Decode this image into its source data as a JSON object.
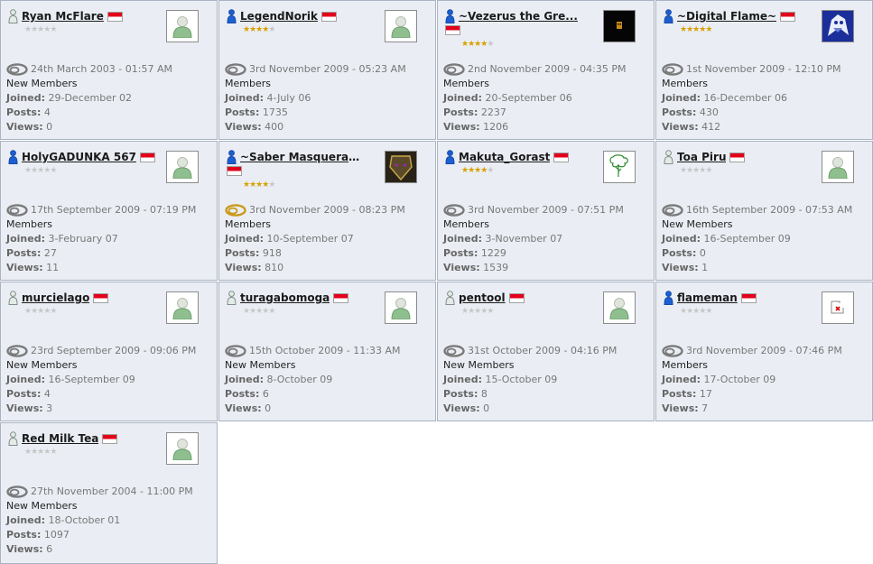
{
  "labels": {
    "joined": "Joined:",
    "posts": "Posts:",
    "views": "Views:"
  },
  "colors": {
    "card_bg": "#eaeef4",
    "card_border": "#a9b3c1",
    "flag_red": "#e3001b",
    "star_gold": "#d9a000",
    "rank_blue": "#1d5fd1"
  },
  "members": [
    {
      "name": "Ryan McFlare",
      "stars": 0,
      "rank_icon": "person-outline-icon",
      "avatar": "default-avatar-icon",
      "status": "offline-status-icon",
      "last_active": "24th March 2003 - 01:57 AM",
      "group": "New Members",
      "joined": "29-December 02",
      "posts": "4",
      "views": "0"
    },
    {
      "name": "LegendNorik",
      "stars": 4,
      "rank_icon": "person-blue-icon",
      "avatar": "default-avatar-icon",
      "status": "offline-status-icon",
      "last_active": "3rd November 2009 - 05:23 AM",
      "group": "Members",
      "joined": "4-July 06",
      "posts": "1735",
      "views": "400"
    },
    {
      "name": "~Vezerus the Gre...",
      "stars": 4,
      "rank_icon": "person-blue-icon",
      "avatar": "dark-pixel-avatar-icon",
      "status": "offline-status-icon",
      "last_active": "2nd November 2009 - 04:35 PM",
      "group": "Members",
      "joined": "20-September 06",
      "posts": "2237",
      "views": "1206"
    },
    {
      "name": "~Digital Flame~",
      "stars": 5,
      "rank_icon": "person-blue-icon",
      "avatar": "creature-avatar-icon",
      "status": "offline-status-icon",
      "last_active": "1st November 2009 - 12:10 PM",
      "group": "Members",
      "joined": "16-December 06",
      "posts": "430",
      "views": "412"
    },
    {
      "name": "HolyGADUNKA 567",
      "stars": 0,
      "rank_icon": "person-blue-icon",
      "avatar": "default-avatar-icon",
      "status": "offline-status-icon",
      "last_active": "17th September 2009 - 07:19 PM",
      "group": "Members",
      "joined": "3-February 07",
      "posts": "27",
      "views": "11"
    },
    {
      "name": "~Saber Masquerad...",
      "stars": 4,
      "rank_icon": "person-blue-icon",
      "avatar": "mask-avatar-icon",
      "status": "online-status-icon",
      "last_active": "3rd November 2009 - 08:23 PM",
      "group": "Members",
      "joined": "10-September 07",
      "posts": "918",
      "views": "810"
    },
    {
      "name": "Makuta_Gorast",
      "stars": 4,
      "rank_icon": "person-blue-icon",
      "avatar": "tree-avatar-icon",
      "status": "offline-status-icon",
      "last_active": "3rd November 2009 - 07:51 PM",
      "group": "Members",
      "joined": "3-November 07",
      "posts": "1229",
      "views": "1539"
    },
    {
      "name": "Toa Piru",
      "stars": 0,
      "rank_icon": "person-outline-icon",
      "avatar": "default-avatar-icon",
      "status": "offline-status-icon",
      "last_active": "16th September 2009 - 07:53 AM",
      "group": "New Members",
      "joined": "16-September 09",
      "posts": "0",
      "views": "1"
    },
    {
      "name": "murcielago",
      "stars": 0,
      "rank_icon": "person-outline-icon",
      "avatar": "default-avatar-icon",
      "status": "offline-status-icon",
      "last_active": "23rd September 2009 - 09:06 PM",
      "group": "New Members",
      "joined": "16-September 09",
      "posts": "4",
      "views": "3"
    },
    {
      "name": "turagabomoga",
      "stars": 0,
      "rank_icon": "person-outline-icon",
      "avatar": "default-avatar-icon",
      "status": "offline-status-icon",
      "last_active": "15th October 2009 - 11:33 AM",
      "group": "New Members",
      "joined": "8-October 09",
      "posts": "6",
      "views": "0"
    },
    {
      "name": "pentool",
      "stars": 0,
      "rank_icon": "person-outline-icon",
      "avatar": "default-avatar-icon",
      "status": "offline-status-icon",
      "last_active": "31st October 2009 - 04:16 PM",
      "group": "New Members",
      "joined": "15-October 09",
      "posts": "8",
      "views": "0"
    },
    {
      "name": "flameman",
      "stars": 0,
      "rank_icon": "person-blue-icon",
      "avatar": "broken-image-icon",
      "status": "offline-status-icon",
      "last_active": "3rd November 2009 - 07:46 PM",
      "group": "Members",
      "joined": "17-October 09",
      "posts": "17",
      "views": "7"
    },
    {
      "name": "Red Milk Tea",
      "stars": 0,
      "rank_icon": "person-outline-icon",
      "avatar": "default-avatar-icon",
      "status": "offline-status-icon",
      "last_active": "27th November 2004 - 11:00 PM",
      "group": "New Members",
      "joined": "18-October 01",
      "posts": "1097",
      "views": "6"
    }
  ]
}
